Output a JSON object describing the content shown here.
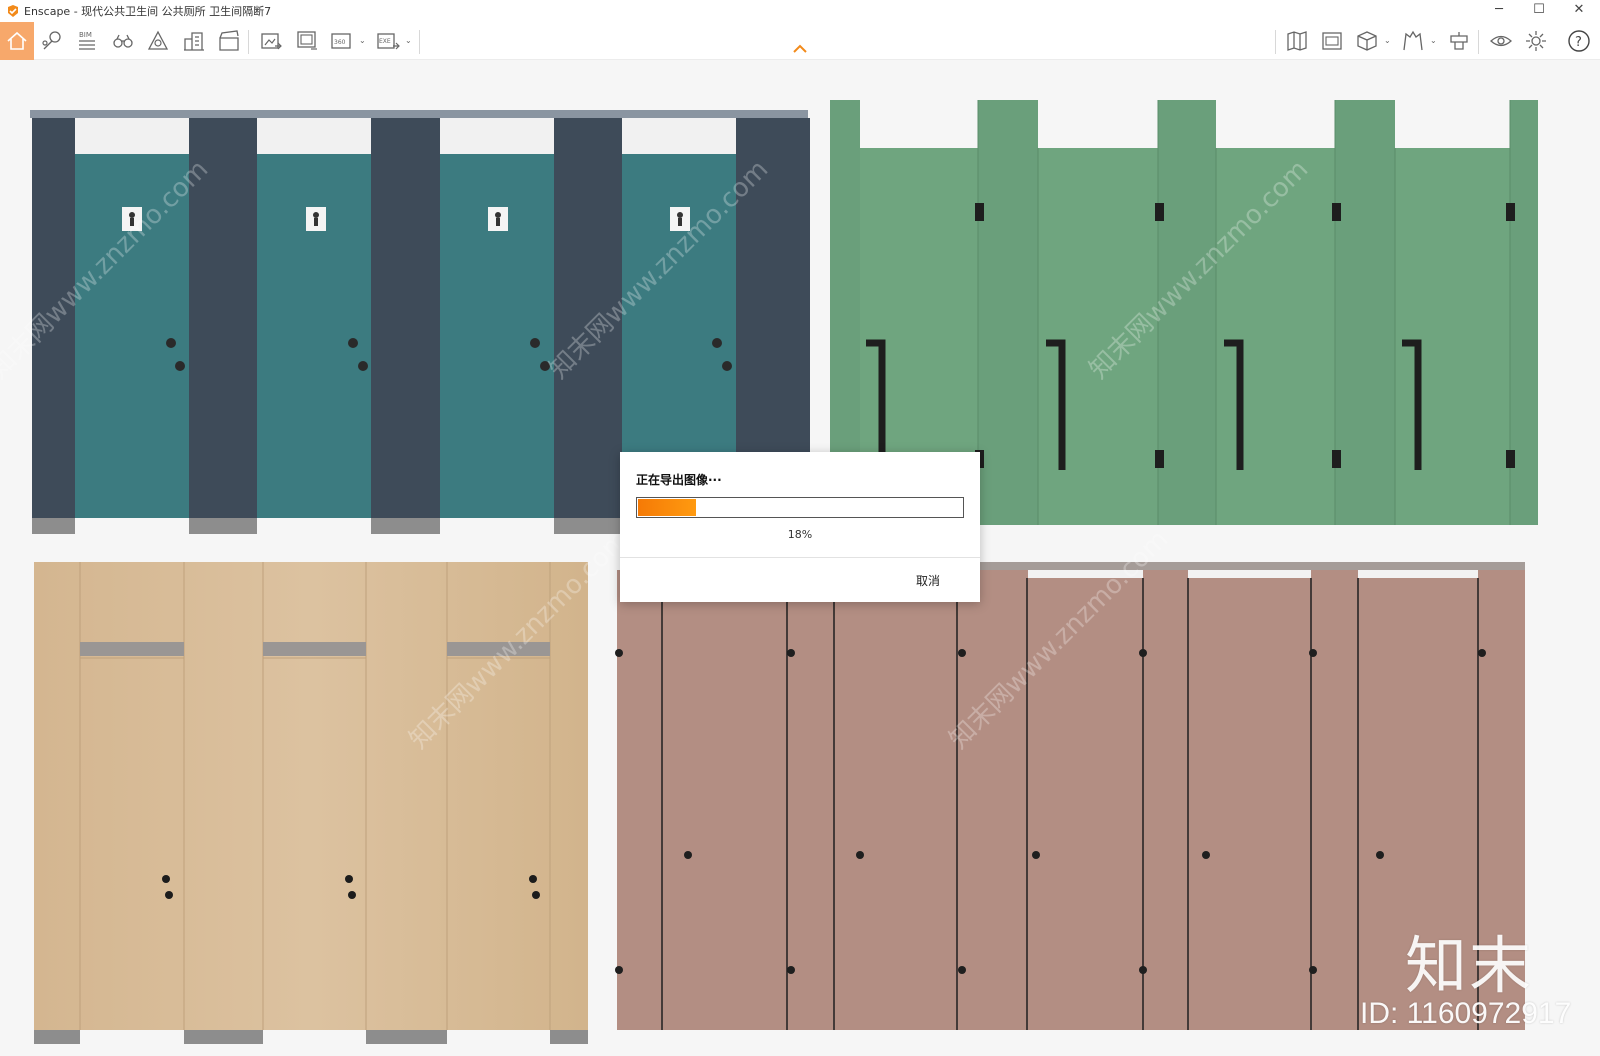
{
  "window": {
    "app_name": "Enscape",
    "title": "Enscape - 现代公共卫生间 公共厕所 卫生间隔断7",
    "controls": [
      "minimize",
      "maximize",
      "close"
    ]
  },
  "toolbar": {
    "bim_label": "BIM",
    "left_tools": [
      "home-icon",
      "pin-icon",
      "bim-list-icon",
      "binoculars-icon",
      "atlas-icon",
      "buildings-icon",
      "clapperboard-icon"
    ],
    "export_tools": [
      "screenshot-export-icon",
      "batch-export-icon",
      "panorama-360-icon",
      "exe-export-icon"
    ],
    "right_tools": [
      "map-icon",
      "asset-library-icon",
      "cube-view-icon",
      "material-editor-icon",
      "render-settings-icon",
      "visual-settings-icon",
      "gear-icon",
      "help-icon"
    ],
    "panorama_label": "360",
    "exe_label": "EXE",
    "accent_color": "#f7a86b"
  },
  "dialog": {
    "title": "正在导出图像···",
    "progress_fraction": 0.18,
    "progress_text": "18%",
    "cancel_label": "取消"
  },
  "watermark": {
    "brand": "知末",
    "id_text": "ID: 1160972917",
    "diagonal_text": "知末网www.znzmo.com"
  },
  "scene": {
    "panels": [
      {
        "name": "teal-partitions",
        "door_color": "#3d7c80",
        "frame_color": "#3d4a57"
      },
      {
        "name": "green-partitions",
        "door_color": "#6a9f7b"
      },
      {
        "name": "wood-partitions",
        "door_color": "#d8bb98"
      },
      {
        "name": "pink-partitions",
        "door_color": "#b38e83"
      }
    ]
  }
}
